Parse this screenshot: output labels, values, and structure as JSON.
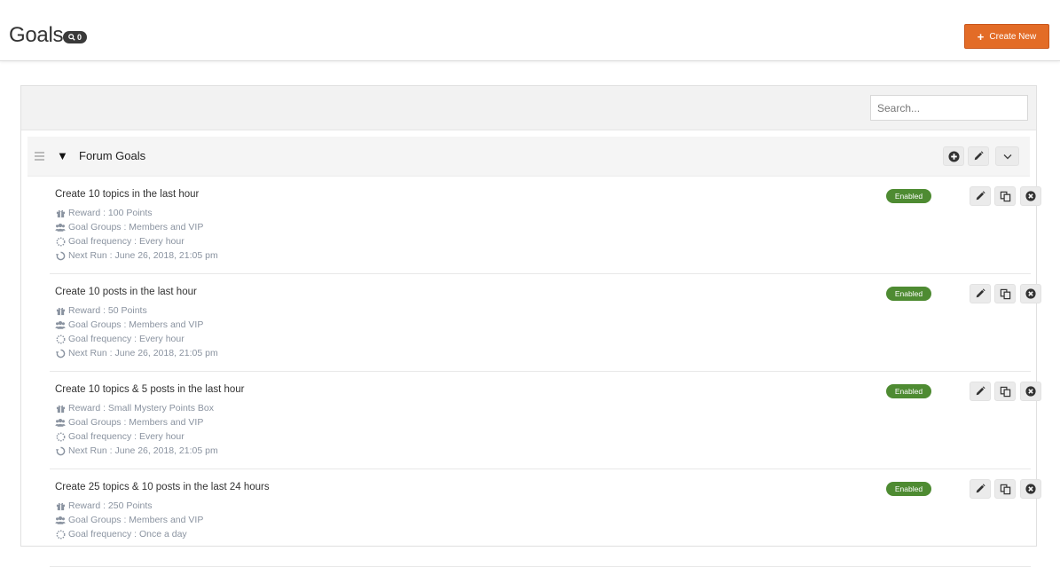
{
  "header": {
    "title": "Goals",
    "count": "0",
    "create_label": "Create New",
    "create_color": "#e36c27"
  },
  "toolbar": {
    "search_placeholder": "Search..."
  },
  "category": {
    "title": "Forum Goals",
    "toggle": "▼",
    "actions": [
      "add-icon",
      "pencil-icon",
      "chevron-down-icon"
    ]
  },
  "goals": [
    {
      "title": "Create 10 topics in the last hour",
      "reward": "Reward : 100 Points",
      "groups": "Goal Groups : Members and VIP",
      "frequency": "Goal frequency : Every hour",
      "next_run": "Next Run : June 26, 2018, 21:05 pm",
      "status": "Enabled"
    },
    {
      "title": "Create 10 posts in the last hour",
      "reward": "Reward : 50 Points",
      "groups": "Goal Groups : Members and VIP",
      "frequency": "Goal frequency : Every hour",
      "next_run": "Next Run : June 26, 2018, 21:05 pm",
      "status": "Enabled"
    },
    {
      "title": "Create 10 topics & 5 posts in the last hour",
      "reward": "Reward : Small Mystery Points Box",
      "groups": "Goal Groups : Members and VIP",
      "frequency": "Goal frequency : Every hour",
      "next_run": "Next Run : June 26, 2018, 21:05 pm",
      "status": "Enabled"
    },
    {
      "title": "Create 25 topics & 10 posts in the last 24 hours",
      "reward": "Reward : 250 Points",
      "groups": "Goal Groups : Members and VIP",
      "frequency": "Goal frequency : Once a day",
      "next_run": "",
      "status": "Enabled"
    }
  ],
  "colors": {
    "enabled_badge": "#4e8b32",
    "meta_text": "#8a93a0"
  }
}
